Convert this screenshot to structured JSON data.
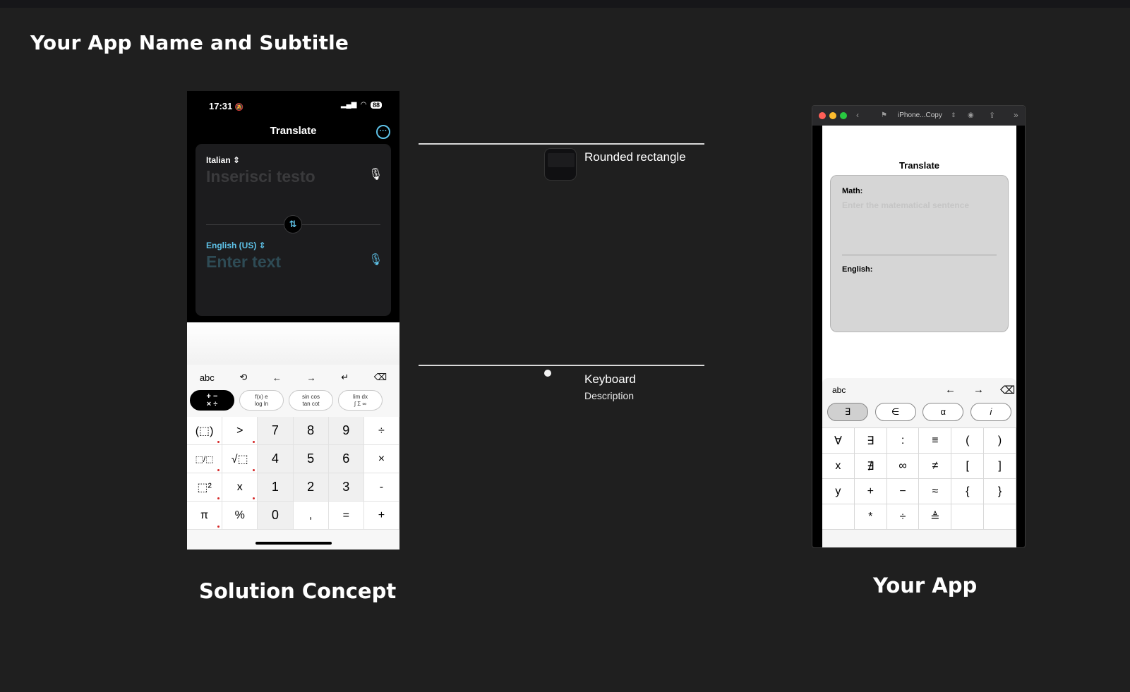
{
  "page": {
    "title": "Your App Name and Subtitle"
  },
  "captions": {
    "left": "Solution Concept",
    "right": "Your App"
  },
  "concept": {
    "status": {
      "time": "17:31",
      "bell": "🔕",
      "signal": "▂▄▆",
      "wifi": "◠",
      "battery": "88"
    },
    "nav_title": "Translate",
    "more_icon": "···",
    "source_lang": "Italian ⇕",
    "source_placeholder": "Inserisci testo",
    "target_lang": "English (US) ⇕",
    "target_placeholder": "Enter text",
    "mic": "🎙",
    "swap": "⇅",
    "keyboard": {
      "toolbar": [
        "abc",
        "⟲",
        "←",
        "→",
        "↵",
        "⌫"
      ],
      "tabs": [
        {
          "l1": "+ −",
          "l2": "× ÷"
        },
        {
          "l1": "f(x)  e",
          "l2": "log  ln"
        },
        {
          "l1": "sin cos",
          "l2": "tan cot"
        },
        {
          "l1": "lim  dx",
          "l2": "∫ Σ ∞"
        }
      ],
      "keys": [
        [
          "(⬚)",
          ">",
          "7",
          "8",
          "9",
          "÷"
        ],
        [
          "⬚/⬚",
          "√⬚",
          "4",
          "5",
          "6",
          "×"
        ],
        [
          "⬚²",
          "x",
          "1",
          "2",
          "3",
          "-"
        ],
        [
          "π",
          "%",
          "0",
          ",",
          "=",
          "+"
        ]
      ]
    }
  },
  "layers": [
    {
      "title": "Rounded rectangle",
      "description": ""
    },
    {
      "title": "Keyboard",
      "description": "Description"
    }
  ],
  "app": {
    "window_title": "iPhone...Copy",
    "translate_title": "Translate",
    "math_label": "Math:",
    "math_placeholder": "Enter the matematical sentence",
    "english_label": "English:",
    "kb_abc": "abc",
    "kb_left": "←",
    "kb_right": "→",
    "kb_delete": "⌫",
    "kb_tabs": [
      "∃",
      "∈",
      "α",
      "𝑖"
    ],
    "kb_keys": [
      [
        "∀",
        "∃",
        ":",
        "≡",
        "(",
        ")"
      ],
      [
        "x",
        "∄",
        "∞",
        "≠",
        "[",
        "]"
      ],
      [
        "y",
        "+",
        "−",
        "≈",
        "{",
        "}"
      ],
      [
        "",
        "*",
        "÷",
        "≜",
        "",
        ""
      ]
    ]
  }
}
